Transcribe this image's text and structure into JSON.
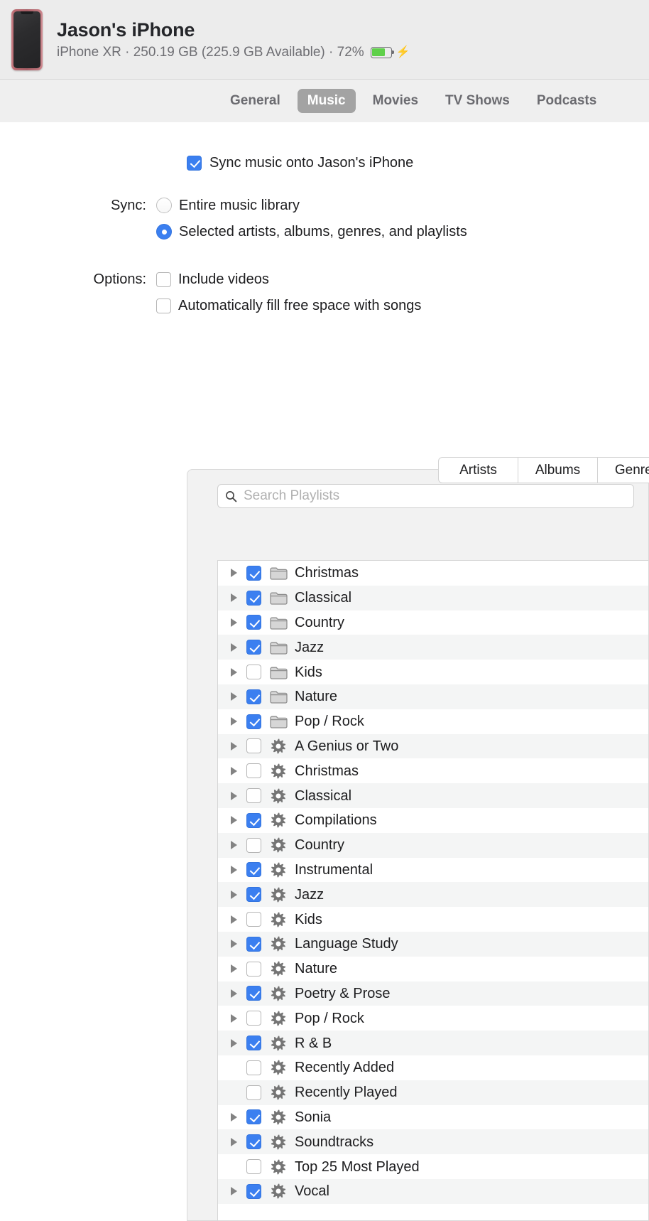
{
  "header": {
    "device_name": "Jason's iPhone",
    "subtitle": "iPhone XR · 250.19 GB (225.9 GB Available) · 72%",
    "battery_percent": 72,
    "battery_color": "#5fd04a",
    "charging_glyph": "⚡",
    "device_icon": "iphone-icon"
  },
  "tabs": [
    {
      "label": "General",
      "selected": false
    },
    {
      "label": "Music",
      "selected": true
    },
    {
      "label": "Movies",
      "selected": false
    },
    {
      "label": "TV Shows",
      "selected": false
    },
    {
      "label": "Podcasts",
      "selected": false
    }
  ],
  "sync_master": {
    "label": "Sync music onto Jason's iPhone",
    "checked": true
  },
  "sync": {
    "label": "Sync:",
    "options": [
      {
        "label": "Entire music library",
        "selected": false
      },
      {
        "label": "Selected artists, albums, genres, and playlists",
        "selected": true
      }
    ]
  },
  "options": {
    "label": "Options:",
    "items": [
      {
        "label": "Include videos",
        "checked": false
      },
      {
        "label": "Automatically fill free space with songs",
        "checked": false
      }
    ]
  },
  "panel_tabs": [
    {
      "label": "Artists",
      "selected": true
    },
    {
      "label": "Albums",
      "selected": false
    },
    {
      "label": "Genres",
      "selected": false
    }
  ],
  "search": {
    "placeholder": "Search Playlists",
    "value": "",
    "icon": "search-icon"
  },
  "accent_color": "#3b7ff0",
  "playlists": [
    {
      "name": "Christmas",
      "checked": true,
      "icon": "folder-icon",
      "expandable": true
    },
    {
      "name": "Classical",
      "checked": true,
      "icon": "folder-icon",
      "expandable": true
    },
    {
      "name": "Country",
      "checked": true,
      "icon": "folder-icon",
      "expandable": true
    },
    {
      "name": "Jazz",
      "checked": true,
      "icon": "folder-icon",
      "expandable": true
    },
    {
      "name": "Kids",
      "checked": false,
      "icon": "folder-icon",
      "expandable": true
    },
    {
      "name": "Nature",
      "checked": true,
      "icon": "folder-icon",
      "expandable": true
    },
    {
      "name": "Pop / Rock",
      "checked": true,
      "icon": "folder-icon",
      "expandable": true
    },
    {
      "name": "A Genius or Two",
      "checked": false,
      "icon": "gear-icon",
      "expandable": true
    },
    {
      "name": "Christmas",
      "checked": false,
      "icon": "gear-icon",
      "expandable": true
    },
    {
      "name": "Classical",
      "checked": false,
      "icon": "gear-icon",
      "expandable": true
    },
    {
      "name": "Compilations",
      "checked": true,
      "icon": "gear-icon",
      "expandable": true
    },
    {
      "name": "Country",
      "checked": false,
      "icon": "gear-icon",
      "expandable": true
    },
    {
      "name": "Instrumental",
      "checked": true,
      "icon": "gear-icon",
      "expandable": true
    },
    {
      "name": "Jazz",
      "checked": true,
      "icon": "gear-icon",
      "expandable": true
    },
    {
      "name": "Kids",
      "checked": false,
      "icon": "gear-icon",
      "expandable": true
    },
    {
      "name": "Language Study",
      "checked": true,
      "icon": "gear-icon",
      "expandable": true
    },
    {
      "name": "Nature",
      "checked": false,
      "icon": "gear-icon",
      "expandable": true
    },
    {
      "name": "Poetry & Prose",
      "checked": true,
      "icon": "gear-icon",
      "expandable": true
    },
    {
      "name": "Pop / Rock",
      "checked": false,
      "icon": "gear-icon",
      "expandable": true
    },
    {
      "name": "R & B",
      "checked": true,
      "icon": "gear-icon",
      "expandable": true
    },
    {
      "name": "Recently Added",
      "checked": false,
      "icon": "gear-icon",
      "expandable": false
    },
    {
      "name": "Recently Played",
      "checked": false,
      "icon": "gear-icon",
      "expandable": false
    },
    {
      "name": "Sonia",
      "checked": true,
      "icon": "gear-icon",
      "expandable": true
    },
    {
      "name": "Soundtracks",
      "checked": true,
      "icon": "gear-icon",
      "expandable": true
    },
    {
      "name": "Top 25 Most Played",
      "checked": false,
      "icon": "gear-icon",
      "expandable": false
    },
    {
      "name": "Vocal",
      "checked": true,
      "icon": "gear-icon",
      "expandable": true
    }
  ]
}
